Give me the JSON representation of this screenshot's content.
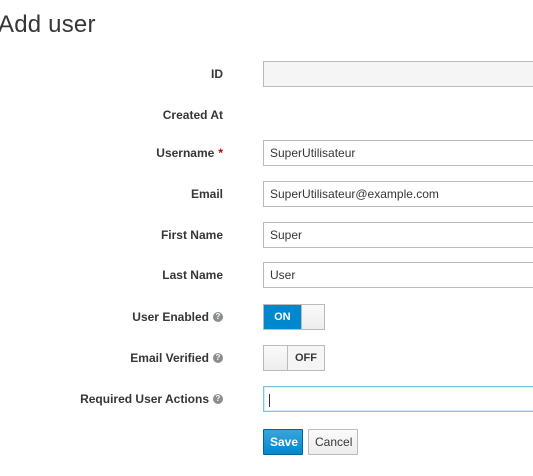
{
  "page": {
    "title": "Add user"
  },
  "form": {
    "id": {
      "label": "ID",
      "value": ""
    },
    "created_at": {
      "label": "Created At",
      "value": ""
    },
    "username": {
      "label": "Username",
      "required_marker": "*",
      "value": "SuperUtilisateur"
    },
    "email": {
      "label": "Email",
      "value": "SuperUtilisateur@example.com"
    },
    "first_name": {
      "label": "First Name",
      "value": "Super"
    },
    "last_name": {
      "label": "Last Name",
      "value": "User"
    },
    "user_enabled": {
      "label": "User Enabled",
      "state_label": "ON",
      "on": true,
      "help_icon": "question-circle-icon"
    },
    "email_verified": {
      "label": "Email Verified",
      "state_label": "OFF",
      "on": false,
      "help_icon": "question-circle-icon"
    },
    "required_user_actions": {
      "label": "Required User Actions",
      "value": "",
      "help_icon": "question-circle-icon"
    }
  },
  "actions": {
    "save_label": "Save",
    "cancel_label": "Cancel"
  },
  "colors": {
    "accent": "#0088ce",
    "required": "#cc0000",
    "border": "#bbbbbb",
    "text": "#363636"
  }
}
